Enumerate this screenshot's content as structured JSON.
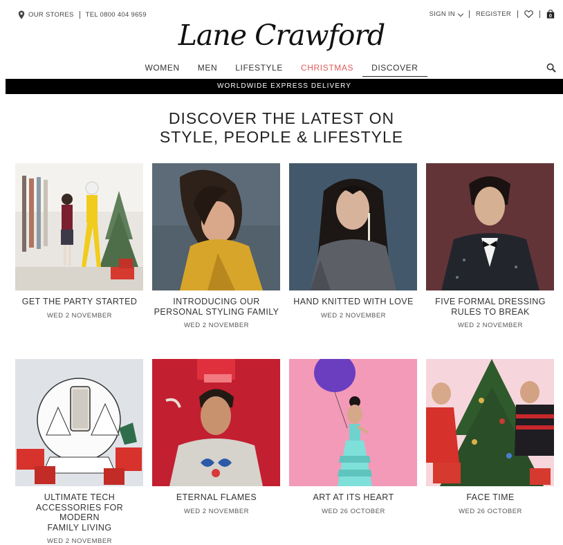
{
  "topbar": {
    "stores_label": "OUR STORES",
    "tel_label": "TEL 0800 404 9659",
    "signin_label": "SIGN IN",
    "register_label": "REGISTER",
    "bag_count": "0"
  },
  "logo": "Lane Crawford",
  "nav": {
    "women": "WOMEN",
    "men": "MEN",
    "lifestyle": "LIFESTYLE",
    "christmas": "CHRISTMAS",
    "discover": "DISCOVER"
  },
  "banner": "WORLDWIDE EXPRESS DELIVERY",
  "heading": {
    "line1": "DISCOVER THE LATEST ON",
    "line2": "STYLE, PEOPLE & LIFESTYLE"
  },
  "articles": [
    {
      "title_lines": [
        "GET THE PARTY STARTED"
      ],
      "date": "WED 2 NOVEMBER"
    },
    {
      "title_lines": [
        "INTRODUCING OUR",
        "PERSONAL STYLING FAMILY"
      ],
      "date": "WED 2 NOVEMBER"
    },
    {
      "title_lines": [
        "HAND KNITTED WITH LOVE"
      ],
      "date": "WED 2 NOVEMBER"
    },
    {
      "title_lines": [
        "FIVE FORMAL DRESSING",
        "RULES TO BREAK"
      ],
      "date": "WED 2 NOVEMBER"
    },
    {
      "title_lines": [
        "ULTIMATE TECH",
        "ACCESSORIES FOR MODERN",
        "FAMILY LIVING"
      ],
      "date": "WED 2 NOVEMBER"
    },
    {
      "title_lines": [
        "ETERNAL FLAMES"
      ],
      "date": "WED 2 NOVEMBER"
    },
    {
      "title_lines": [
        "ART AT ITS HEART"
      ],
      "date": "WED 26 OCTOBER"
    },
    {
      "title_lines": [
        "FACE TIME"
      ],
      "date": "WED 26 OCTOBER"
    }
  ],
  "colors": {
    "christmas_accent": "#e05a5a",
    "banner_bg": "#000000"
  },
  "icons": [
    "location-pin-icon",
    "chevron-down-icon",
    "heart-icon",
    "shopping-bag-icon",
    "search-icon"
  ]
}
